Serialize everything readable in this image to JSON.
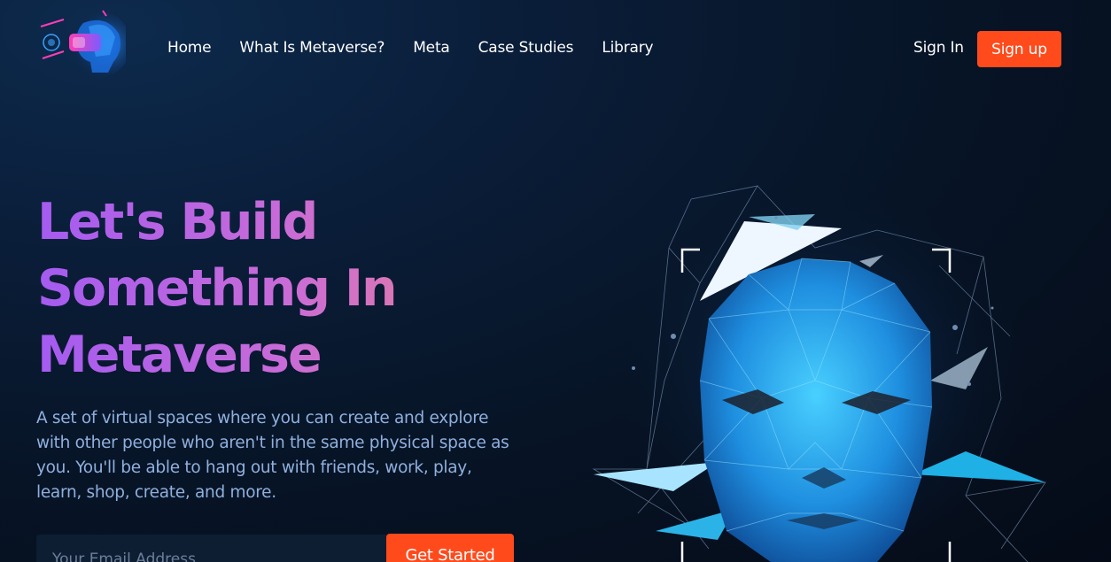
{
  "nav": {
    "logo_icon": "vr-headset-logo-icon",
    "items": [
      {
        "label": "Home"
      },
      {
        "label": "What Is Metaverse?"
      },
      {
        "label": "Meta"
      },
      {
        "label": "Case Studies"
      },
      {
        "label": "Library"
      }
    ],
    "sign_in_label": "Sign In",
    "sign_up_label": "Sign up"
  },
  "hero": {
    "headline_lines": [
      "Let's Build",
      "Something In",
      "Metaverse"
    ],
    "description": "A set of virtual spaces where you can create and explore with other people who aren't in the same physical space as you. You'll be able to hang out with friends, work, play, learn, shop, create, and more.",
    "email_placeholder": "Your Email Address",
    "email_value": "",
    "cta_label": "Get Started",
    "art_icon": "polygon-face-illustration"
  },
  "colors": {
    "accent": "#ff4a1c",
    "headline_gradient_start": "#a45bf0",
    "headline_gradient_end": "#e77da0",
    "description_text": "#8fb0de",
    "background": "#071426"
  }
}
